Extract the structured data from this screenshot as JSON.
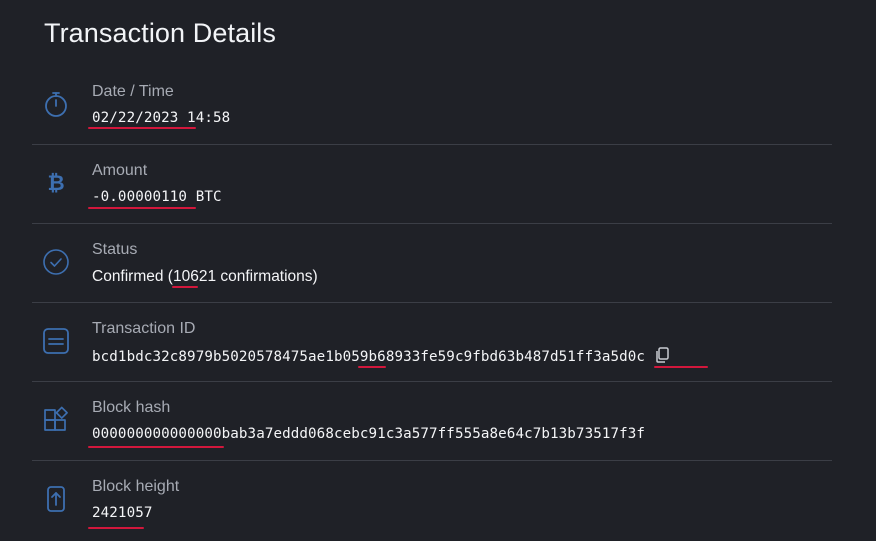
{
  "page": {
    "title": "Transaction Details"
  },
  "rows": [
    {
      "label": "Date / Time",
      "value": "02/22/2023 14:58",
      "icon": "stopwatch-icon"
    },
    {
      "label": "Amount",
      "value": "-0.00000110 BTC",
      "icon": "bitcoin-icon"
    },
    {
      "label": "Status",
      "value": "Confirmed (10621 confirmations)",
      "icon": "check-circle-icon"
    },
    {
      "label": "Transaction ID",
      "value": "bcd1bdc32c8979b5020578475ae1b059b68933fe59c9fbd63b487d51ff3a5d0c",
      "icon": "transaction-card-icon",
      "action_icon": "copy-icon"
    },
    {
      "label": "Block hash",
      "value": "000000000000000bab3a7eddd068cebc91c3a577ff555a8e64c7b13b73517f3f",
      "icon": "blocks-icon"
    },
    {
      "label": "Block height",
      "value": "2421057",
      "icon": "arrow-up-box-icon"
    }
  ],
  "colors": {
    "background": "#1f2127",
    "icon": "#3d6fb0",
    "divider": "#3b3e46",
    "annotation_underline": "#d2173c",
    "label": "#a7abb4",
    "value": "#f4f5f7"
  }
}
